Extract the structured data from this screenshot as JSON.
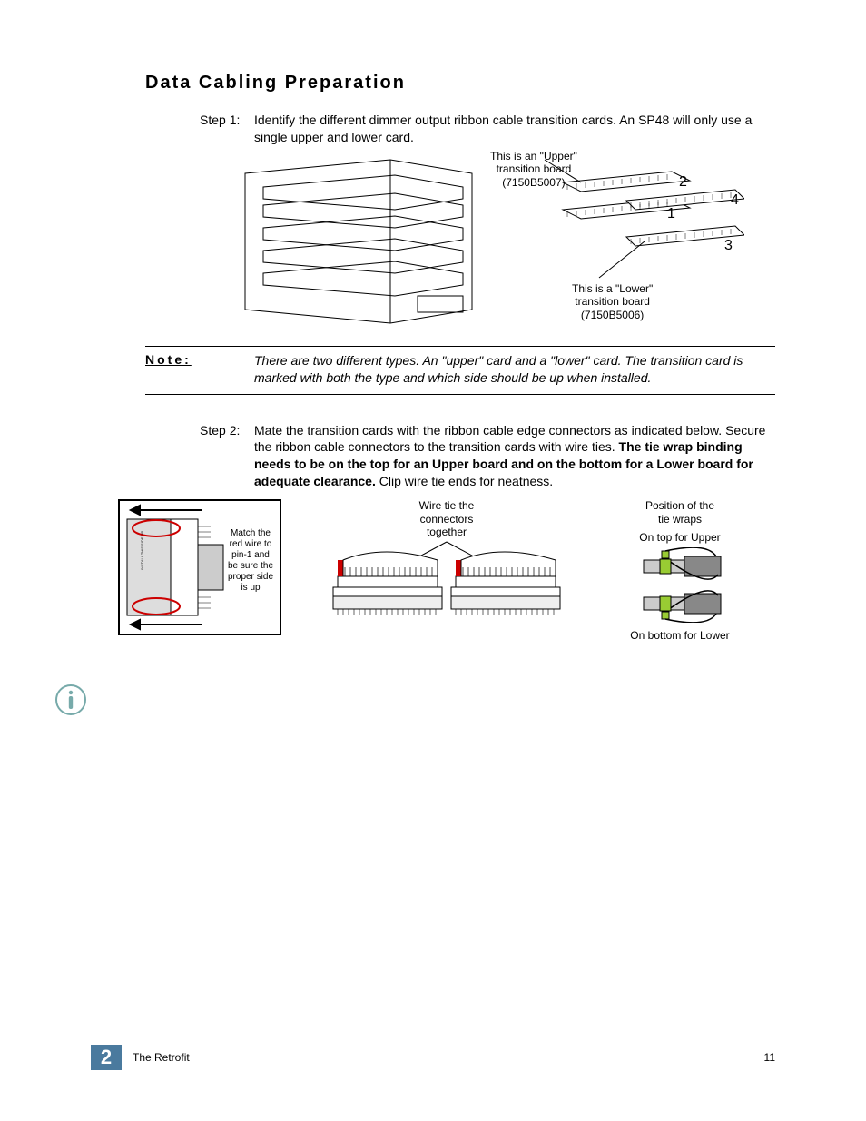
{
  "section_title": "Data Cabling Preparation",
  "step1": {
    "label": "Step 1:",
    "body": "Identify the different dimmer output ribbon cable transition cards. An SP48 will only use a single upper and lower card."
  },
  "figure1": {
    "upper_callout_l1": "This is an \"Upper\"",
    "upper_callout_l2": "transition board",
    "upper_callout_l3": "(7150B5007)",
    "lower_callout_l1": "This is a \"Lower\"",
    "lower_callout_l2": "transition board",
    "lower_callout_l3": "(7150B5006)",
    "n1": "1",
    "n2": "2",
    "n3": "3",
    "n4": "4"
  },
  "note": {
    "label": "Note:",
    "body": "There are two different types. An \"upper\" card and a \"lower\" card. The transition card is marked with both the type and which side should be up when installed."
  },
  "step2": {
    "label": "Step 2:",
    "body_a": "Mate the transition cards with the ribbon cable edge connectors as indicated below. Secure the ribbon cable connectors to the transition cards with wire ties. ",
    "body_bold": "The tie wrap binding needs to be on the top for an Upper board and on the bottom for a Lower board for adequate clearance.",
    "body_b": " Clip wire tie ends for neatness."
  },
  "figure2": {
    "fig2a_text": "Match the red wire to pin-1 and be sure the proper side is up",
    "fig2b_label_l1": "Wire tie the",
    "fig2b_label_l2": "connectors",
    "fig2b_label_l3": "together",
    "fig2c_title_l1": "Position of the",
    "fig2c_title_l2": "tie wraps",
    "fig2c_upper": "On top for Upper",
    "fig2c_lower": "On bottom for Lower"
  },
  "footer": {
    "chapter_num": "2",
    "chapter_title": "The Retrofit",
    "page_num": "11"
  }
}
